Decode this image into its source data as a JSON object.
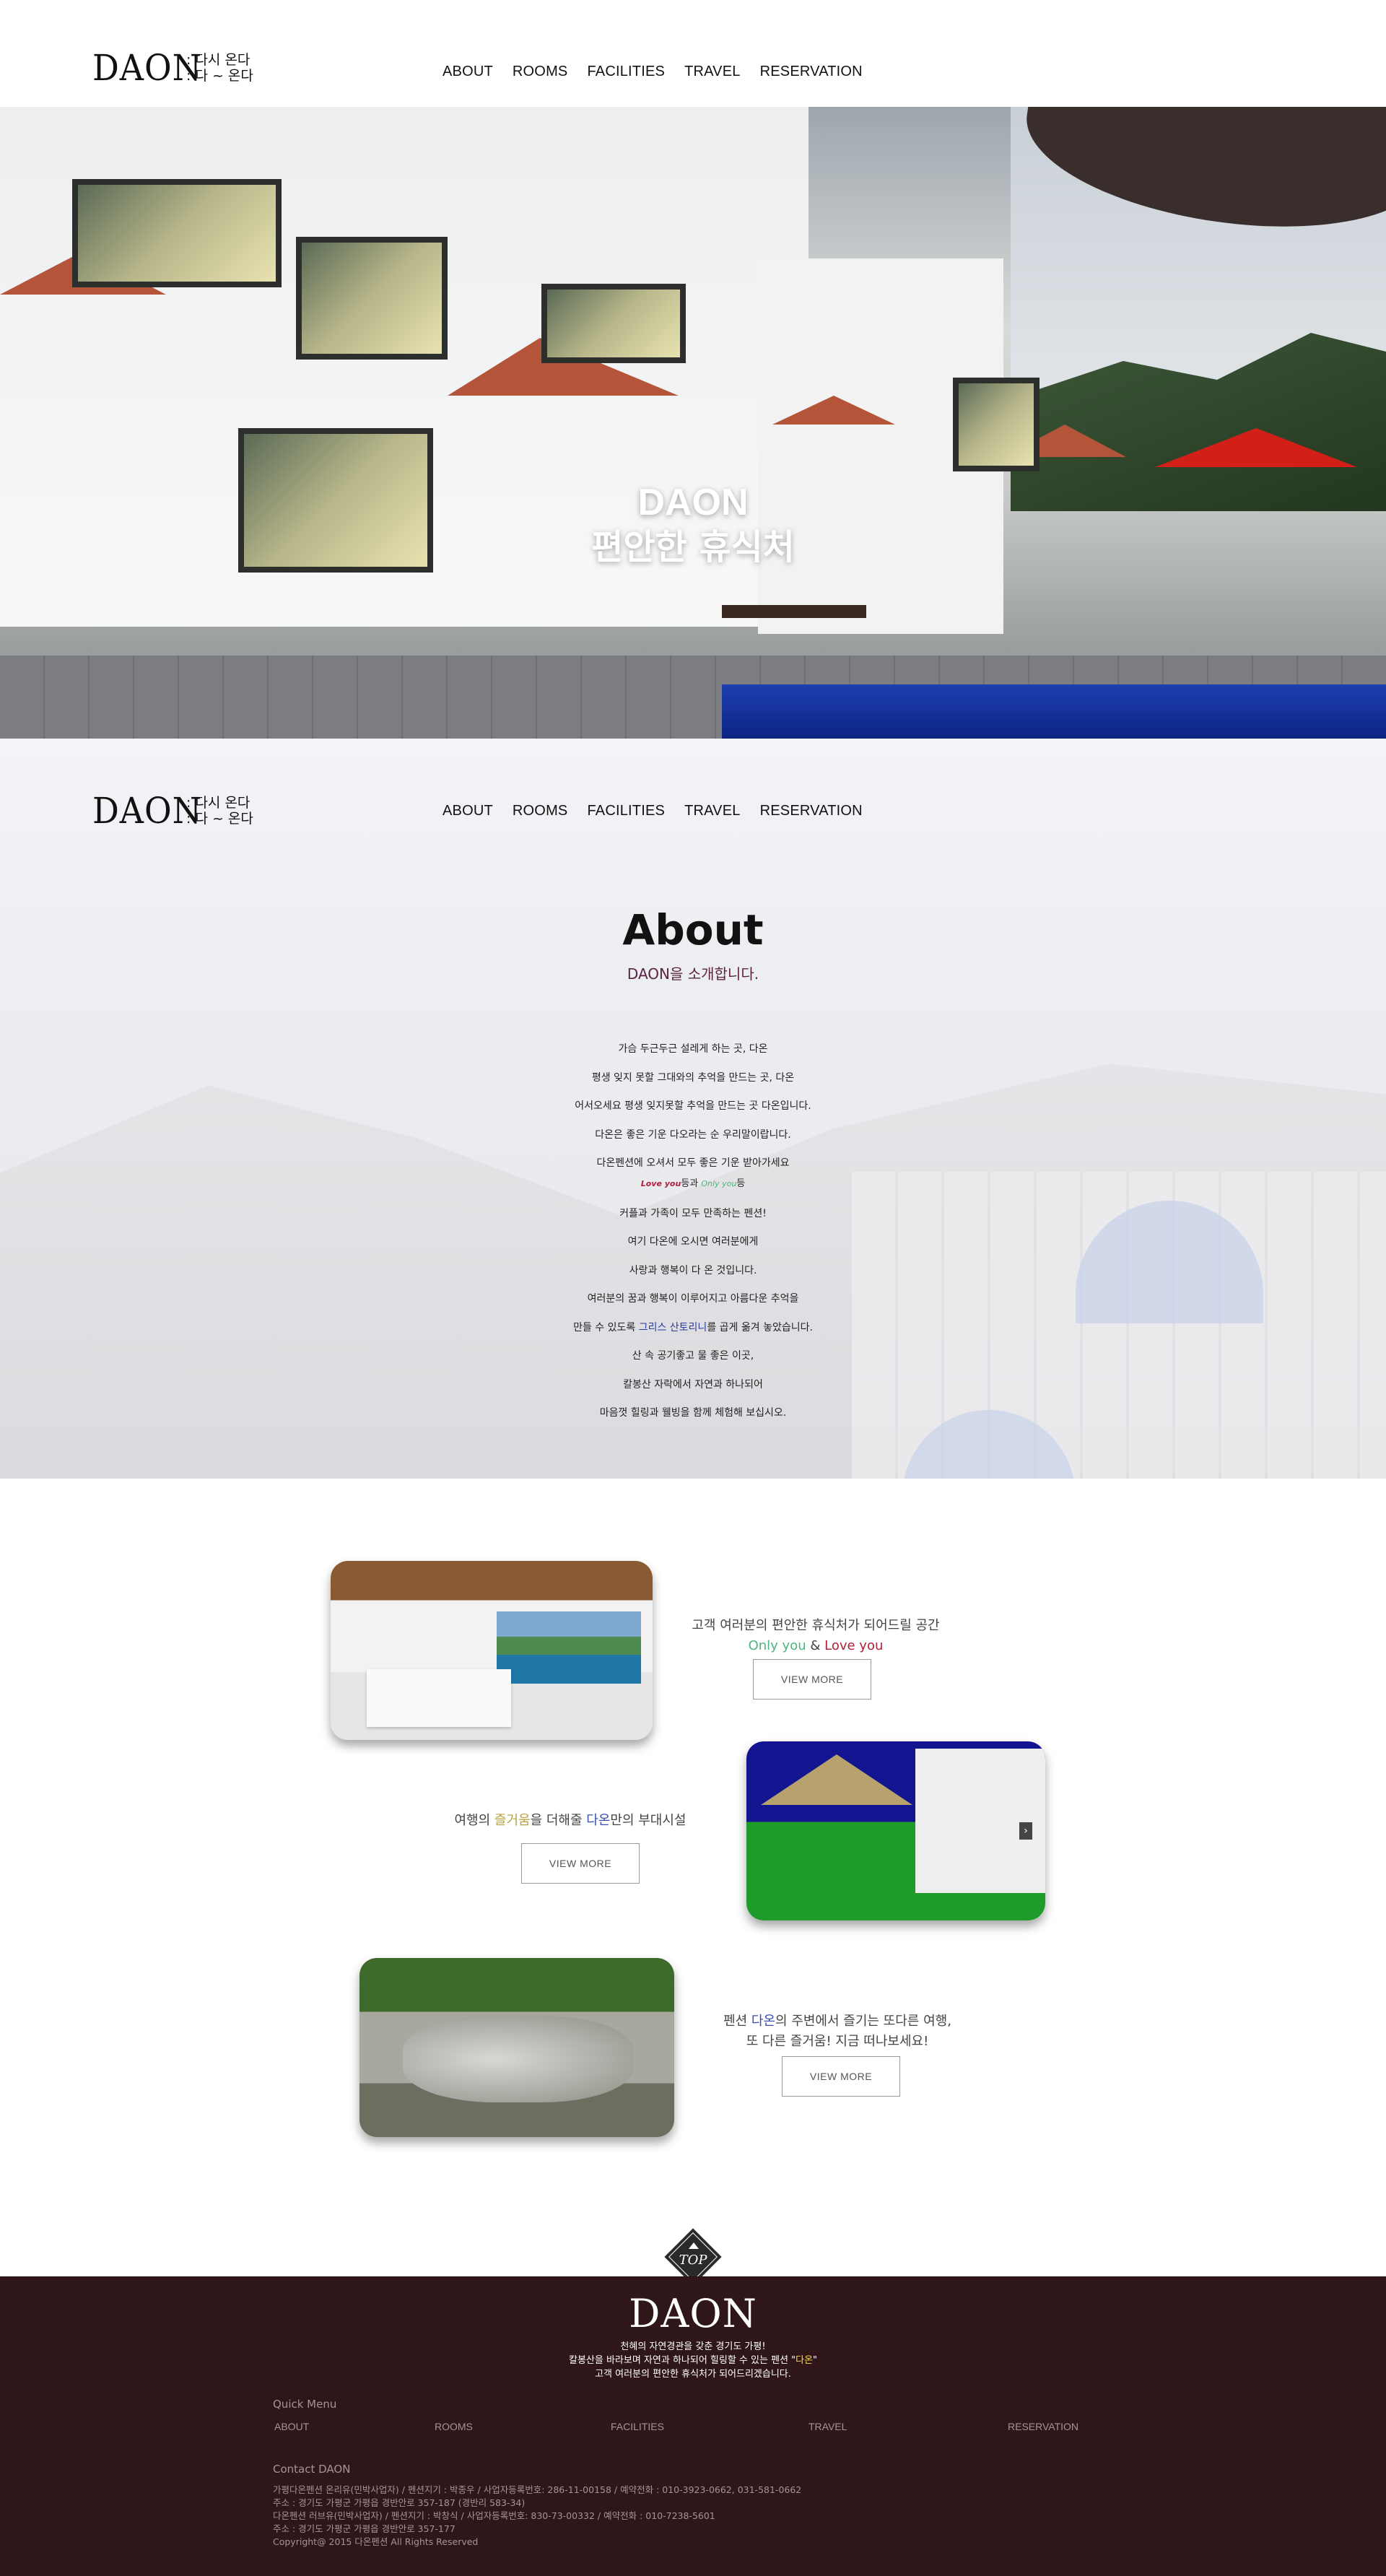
{
  "header": {
    "logo": "DAON",
    "logo_sub_1": ": 다시 온다",
    "logo_sub_2": ": 다 ~ 온다",
    "nav": [
      "ABOUT",
      "ROOMS",
      "FACILITIES",
      "TRAVEL",
      "RESERVATION"
    ]
  },
  "hero": {
    "title": "DAON",
    "subtitle": "편안한 휴식처"
  },
  "about": {
    "title": "About",
    "subtitle": "DAON을 소개합니다.",
    "lines": [
      "가슴 두근두근 설레게 하는 곳, 다온",
      "평생 잊지 못할 그대와의 추억을 만드는 곳, 다온",
      "어서오세요 평생 잊지못할 추억을 만드는 곳 다온입니다.",
      "다온은 좋은 기운 다오라는 순 우리말이랍니다.",
      "다온펜션에 오셔서 모두 좋은 기운 받아가세요"
    ],
    "love_line": {
      "love_you": "Love you",
      "mid": "등과 ",
      "only_you": "Only you",
      "end": "등"
    },
    "lines_2": [
      "커플과 가족이 모두 만족하는 펜션!",
      "여기 다온에 오시면 여러분에게",
      "사랑과 행복이 다 온 것입니다.",
      "여러분의 꿈과 행복이 이루어지고 아름다운 추억을"
    ],
    "santorini_line": {
      "pre": "만들 수 있도록 ",
      "hl": "그리스 산토리니",
      "post": "를 곱게 옮겨 놓았습니다."
    },
    "lines_3": [
      "산 속 공기좋고 물 좋은 이곳,",
      "칼봉산 자락에서 자연과 하나되어",
      "마음껏 힐링과 웰빙을 함께 체험해 보십시오."
    ]
  },
  "features": {
    "f1": {
      "line1": "고객 여러분의 편안한 휴식처가 되어드릴 공간",
      "only_you": "Only you",
      "amp": " & ",
      "love_you": "Love you"
    },
    "f2": {
      "pre": "여행의 ",
      "hl1": "즐거움",
      "mid": "을 더해줄 ",
      "hl2": "다온",
      "post": "만의 부대시설"
    },
    "f3": {
      "pre": "펜션 ",
      "hl": "다온",
      "post": "의 주변에서 즐기는 또다른 여행,",
      "line2": "또 다른 즐거움! 지금 떠나보세요!"
    },
    "button_label": "VIEW MORE",
    "next_icon": "›"
  },
  "top_button": {
    "label": "TOP"
  },
  "footer": {
    "logo": "DAON",
    "tagline_1": "천혜의 자연경관을 갖춘 경기도 가평!",
    "tagline_2_pre": "칼봉산을 바라보며 자연과 하나되어 힐링할 수 있는 펜션 \"",
    "tagline_2_hl": "다온",
    "tagline_2_post": "\"",
    "tagline_3": "고객 여러분의 편안한 휴식처가 되어드리겠습니다.",
    "quick_menu_label": "Quick Menu",
    "quick_menu": [
      "ABOUT",
      "ROOMS",
      "FACILITIES",
      "TRAVEL",
      "RESERVATION"
    ],
    "contact_label": "Contact DAON",
    "info": [
      "가평다온펜션 온리유(민박사업자) / 펜션지기 : 박종우 / 사업자등록번호: 286-11-00158 / 예약전화 : 010-3923-0662, 031-581-0662",
      "주소 : 경기도 가평군 가평읍 경반안로 357-187 (경반리 583-34)",
      "다온펜션 러브유(민박사업자) / 펜션지기 : 박창식 / 사업자등록번호: 830-73-00332 / 예약전화 : 010-7238-5601",
      "주소 : 경기도 가평군 가평읍 경반안로 357-177",
      "Copyright@ 2015 다온펜션 All Rights Reserved"
    ]
  }
}
